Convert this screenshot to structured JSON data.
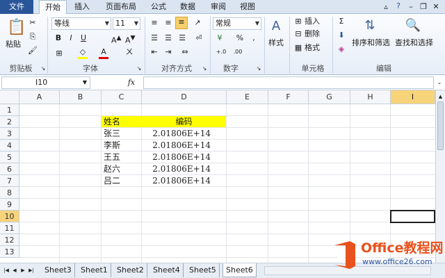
{
  "tabs": [
    "文件",
    "开始",
    "插入",
    "页面布局",
    "公式",
    "数据",
    "审阅",
    "视图"
  ],
  "ribbon": {
    "clipboard": {
      "paste": "粘贴",
      "label": "剪贴板"
    },
    "font": {
      "name": "等线",
      "size": "11",
      "label": "字体",
      "bold": "B",
      "italic": "I",
      "underline": "U"
    },
    "align": {
      "label": "对齐方式"
    },
    "number": {
      "format": "常规",
      "percent": "%",
      "comma": ",",
      "label": "数字"
    },
    "styles": {
      "btn": "样式"
    },
    "cells": {
      "insert": "插入",
      "delete": "删除",
      "format": "格式",
      "label": "单元格"
    },
    "editing": {
      "sort": "排序和筛选",
      "find": "查找和选择",
      "label": "编辑"
    }
  },
  "formula": {
    "namebox": "I10",
    "fx": "fx"
  },
  "columns": [
    "A",
    "B",
    "C",
    "D",
    "E",
    "F",
    "G",
    "H",
    "I"
  ],
  "rows": [
    "1",
    "2",
    "3",
    "4",
    "5",
    "6",
    "7",
    "8",
    "9",
    "10",
    "11",
    "12",
    "13"
  ],
  "cells": {
    "c2": "姓名",
    "d2": "编码",
    "c3": "张三",
    "d3": "2.01806E+14",
    "c4": "李斯",
    "d4": "2.01806E+14",
    "c5": "王五",
    "d5": "2.01806E+14",
    "c6": "赵六",
    "d6": "2.01806E+14",
    "c7": "吕二",
    "d7": "2.01806E+14"
  },
  "sheets": [
    "Sheet3",
    "Sheet1",
    "Sheet2",
    "Sheet4",
    "Sheet5",
    "Sheet6"
  ],
  "logo": {
    "title": "Office教程网",
    "url": "www.office26.com"
  },
  "colors": {
    "accent": "#2a5699",
    "highlight": "#ffff00",
    "selected": "#f7d37a",
    "logo_orange": "#e8521d"
  }
}
